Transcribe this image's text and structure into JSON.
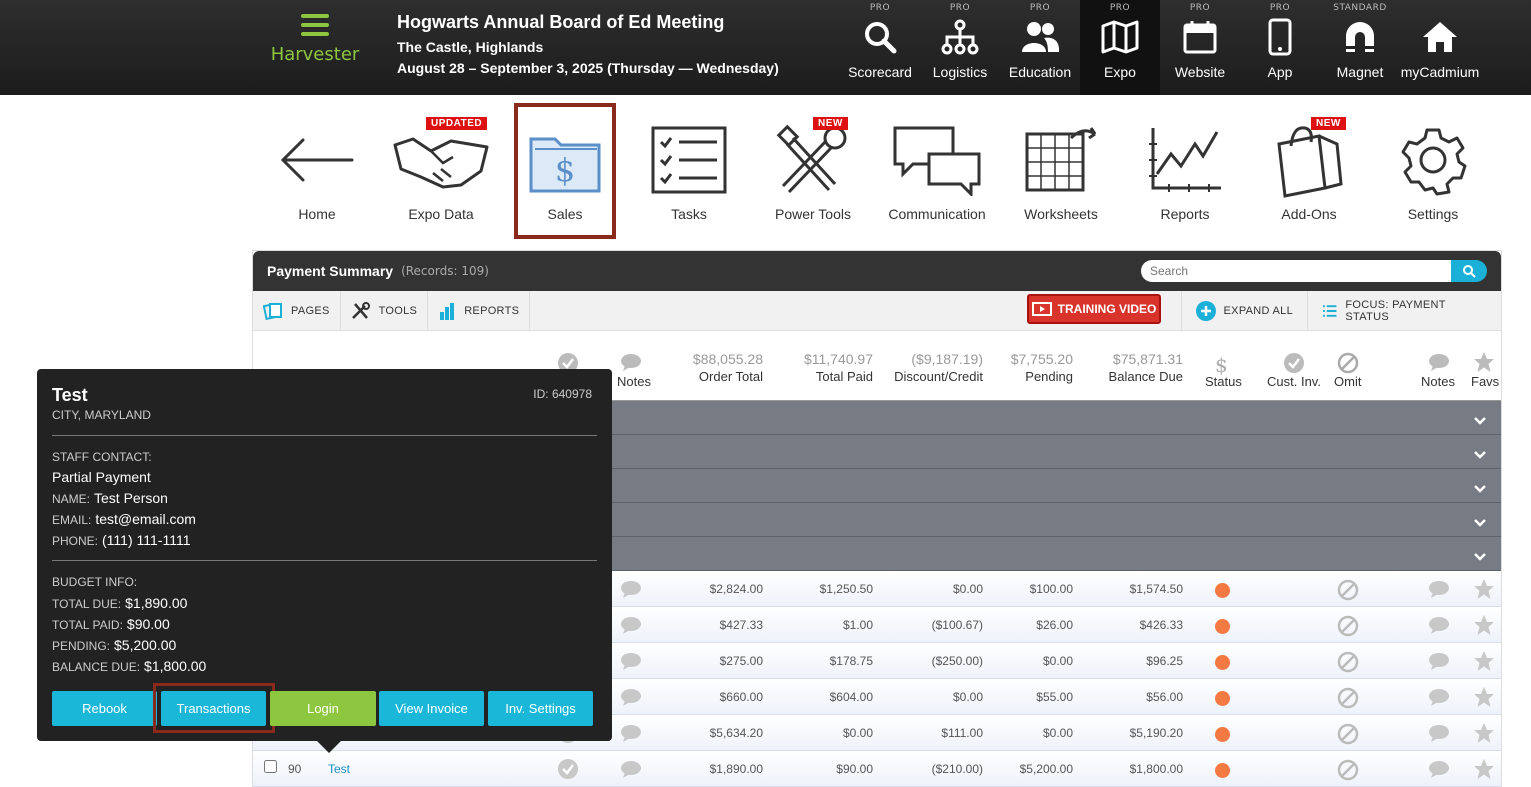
{
  "header": {
    "brand": "Harvester",
    "event_title": "Hogwarts Annual Board of Ed Meeting",
    "event_location": "The Castle, Highlands",
    "event_dates": "August 28 – September 3, 2025 (Thursday — Wednesday)",
    "modules": [
      {
        "tier": "PRO",
        "label": "Scorecard",
        "icon": "search-icon"
      },
      {
        "tier": "PRO",
        "label": "Logistics",
        "icon": "org-chart-icon"
      },
      {
        "tier": "PRO",
        "label": "Education",
        "icon": "users-icon"
      },
      {
        "tier": "PRO",
        "label": "Expo",
        "icon": "map-icon",
        "active": true
      },
      {
        "tier": "PRO",
        "label": "Website",
        "icon": "calendar-icon"
      },
      {
        "tier": "PRO",
        "label": "App",
        "icon": "phone-icon"
      },
      {
        "tier": "STANDARD",
        "label": "Magnet",
        "icon": "magnet-icon"
      },
      {
        "tier": "",
        "label": "myCadmium",
        "icon": "home-icon"
      }
    ]
  },
  "tools": [
    {
      "label": "Home",
      "icon": "back-arrow-icon"
    },
    {
      "label": "Expo Data",
      "icon": "handshake-icon",
      "badge": "UPDATED"
    },
    {
      "label": "Sales",
      "icon": "dollar-folder-icon",
      "selected": true
    },
    {
      "label": "Tasks",
      "icon": "checklist-icon"
    },
    {
      "label": "Power Tools",
      "icon": "wrench-icon",
      "badge": "NEW"
    },
    {
      "label": "Communication",
      "icon": "chat-bubbles-icon"
    },
    {
      "label": "Worksheets",
      "icon": "spreadsheet-icon"
    },
    {
      "label": "Reports",
      "icon": "line-chart-icon"
    },
    {
      "label": "Add-Ons",
      "icon": "shopping-bag-icon",
      "badge": "NEW"
    },
    {
      "label": "Settings",
      "icon": "gear-icon"
    }
  ],
  "panel": {
    "title": "Payment Summary",
    "records": "(Records: 109)",
    "search_placeholder": "Search",
    "toolbar": {
      "pages": "PAGES",
      "tools": "TOOLS",
      "reports": "REPORTS",
      "training": "TRAINING VIDEO",
      "expand": "EXPAND ALL",
      "focus": "FOCUS: PAYMENT STATUS"
    },
    "columns": {
      "notes_left": "Notes",
      "order_total": {
        "amount": "$88,055.28",
        "label": "Order Total"
      },
      "total_paid": {
        "amount": "$11,740.97",
        "label": "Total Paid"
      },
      "discount": {
        "amount": "($9,187.19)",
        "label": "Discount/Credit"
      },
      "pending": {
        "amount": "$7,755.20",
        "label": "Pending"
      },
      "balance": {
        "amount": "$75,871.31",
        "label": "Balance Due"
      },
      "status": "Status",
      "cust_inv": "Cust. Inv.",
      "omit": "Omit",
      "notes": "Notes",
      "favs": "Favs"
    },
    "rows": [
      {
        "order": "$2,824.00",
        "paid": "$1,250.50",
        "discount": "$0.00",
        "pending": "$100.00",
        "balance": "$1,574.50"
      },
      {
        "order": "$427.33",
        "paid": "$1.00",
        "discount": "($100.67)",
        "pending": "$26.00",
        "balance": "$426.33"
      },
      {
        "order": "$275.00",
        "paid": "$178.75",
        "discount": "($250.00)",
        "pending": "$0.00",
        "balance": "$96.25"
      },
      {
        "order": "$660.00",
        "paid": "$604.00",
        "discount": "$0.00",
        "pending": "$55.00",
        "balance": "$56.00"
      },
      {
        "order": "$5,634.20",
        "paid": "$0.00",
        "discount": "$111.00",
        "pending": "$0.00",
        "balance": "$5,190.20"
      },
      {
        "num": "90",
        "name": "Test",
        "order": "$1,890.00",
        "paid": "$90.00",
        "discount": "($210.00)",
        "pending": "$5,200.00",
        "balance": "$1,800.00"
      }
    ]
  },
  "popover": {
    "name": "Test",
    "city": "CITY, MARYLAND",
    "id": "ID: 640978",
    "staff_contact_label": "STAFF CONTACT:",
    "payment_state": "Partial Payment",
    "name_label": "NAME:",
    "name_value": "Test Person",
    "email_label": "EMAIL:",
    "email_value": "test@email.com",
    "phone_label": "PHONE:",
    "phone_value": "(111) 111-1111",
    "budget_label": "BUDGET INFO:",
    "total_due_label": "TOTAL DUE:",
    "total_due_value": "$1,890.00",
    "total_paid_label": "TOTAL PAID:",
    "total_paid_value": "$90.00",
    "pending_label": "PENDING:",
    "pending_value": "$5,200.00",
    "balance_label": "BALANCE DUE:",
    "balance_value": "$1,800.00",
    "buttons": {
      "rebook": "Rebook",
      "transactions": "Transactions",
      "login": "Login",
      "view_invoice": "View Invoice",
      "inv_settings": "Inv. Settings"
    }
  }
}
